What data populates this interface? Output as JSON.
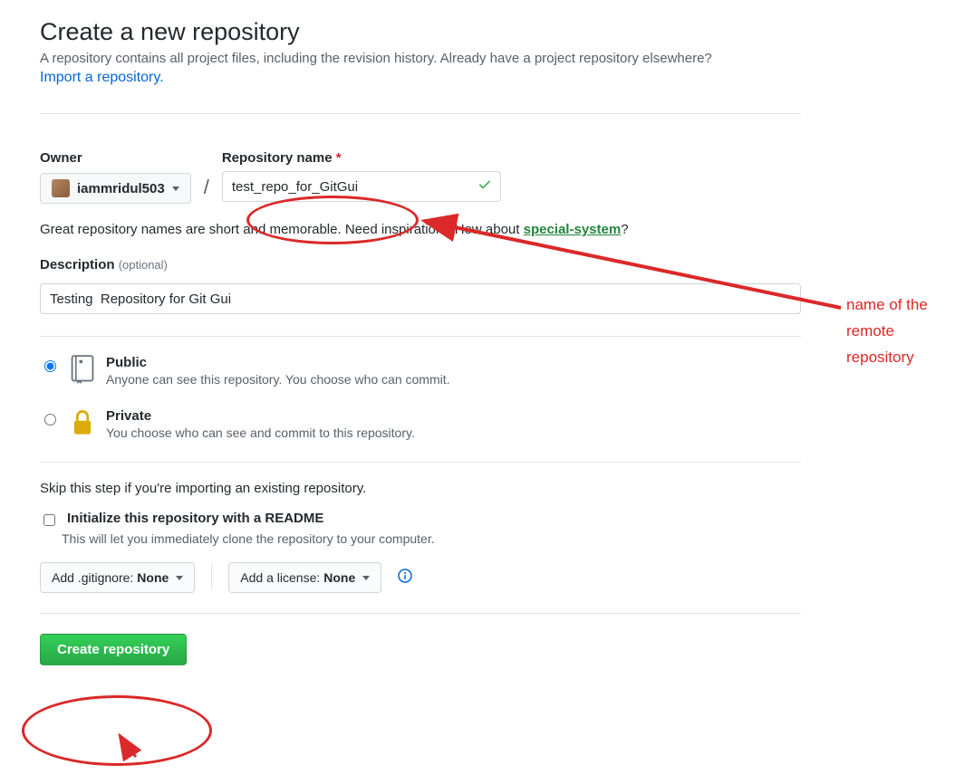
{
  "page": {
    "title": "Create a new repository",
    "subhead": "A repository contains all project files, including the revision history. Already have a project repository elsewhere?",
    "import_link": "Import a repository."
  },
  "owner": {
    "label": "Owner",
    "username": "iammridul503"
  },
  "repo": {
    "label": "Repository name",
    "required_marker": "*",
    "value": "test_repo_for_GitGui"
  },
  "hint": {
    "prefix": "Great repository names are short and memorable. Need inspiration? How about ",
    "suggestion": "special-system",
    "suffix": "?"
  },
  "description": {
    "label": "Description",
    "optional": "(optional)",
    "value": "Testing  Repository for Git Gui"
  },
  "visibility": {
    "public": {
      "title": "Public",
      "desc": "Anyone can see this repository. You choose who can commit."
    },
    "private": {
      "title": "Private",
      "desc": "You choose who can see and commit to this repository."
    }
  },
  "skip_text": "Skip this step if you're importing an existing repository.",
  "readme": {
    "title": "Initialize this repository with a README",
    "desc": "This will let you immediately clone the repository to your computer."
  },
  "gitignore": {
    "label_prefix": "Add .gitignore: ",
    "value": "None"
  },
  "license": {
    "label_prefix": "Add a license: ",
    "value": "None"
  },
  "submit": "Create repository",
  "annotation": {
    "text": "name of the remote repository"
  }
}
